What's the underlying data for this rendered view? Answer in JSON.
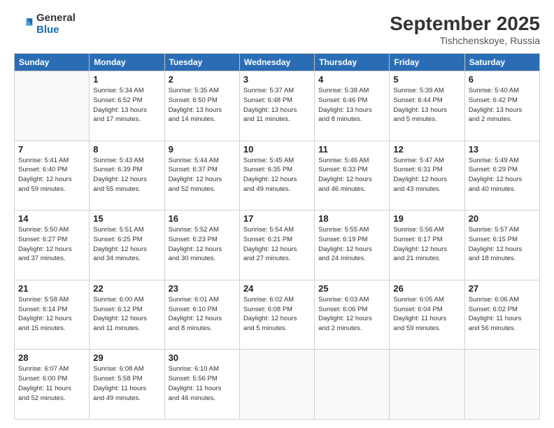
{
  "header": {
    "logo_general": "General",
    "logo_blue": "Blue",
    "month_title": "September 2025",
    "location": "Tishchenskoye, Russia"
  },
  "days_of_week": [
    "Sunday",
    "Monday",
    "Tuesday",
    "Wednesday",
    "Thursday",
    "Friday",
    "Saturday"
  ],
  "weeks": [
    [
      {
        "day": "",
        "info": ""
      },
      {
        "day": "1",
        "info": "Sunrise: 5:34 AM\nSunset: 6:52 PM\nDaylight: 13 hours\nand 17 minutes."
      },
      {
        "day": "2",
        "info": "Sunrise: 5:35 AM\nSunset: 6:50 PM\nDaylight: 13 hours\nand 14 minutes."
      },
      {
        "day": "3",
        "info": "Sunrise: 5:37 AM\nSunset: 6:48 PM\nDaylight: 13 hours\nand 11 minutes."
      },
      {
        "day": "4",
        "info": "Sunrise: 5:38 AM\nSunset: 6:46 PM\nDaylight: 13 hours\nand 8 minutes."
      },
      {
        "day": "5",
        "info": "Sunrise: 5:39 AM\nSunset: 6:44 PM\nDaylight: 13 hours\nand 5 minutes."
      },
      {
        "day": "6",
        "info": "Sunrise: 5:40 AM\nSunset: 6:42 PM\nDaylight: 13 hours\nand 2 minutes."
      }
    ],
    [
      {
        "day": "7",
        "info": "Sunrise: 5:41 AM\nSunset: 6:40 PM\nDaylight: 12 hours\nand 59 minutes."
      },
      {
        "day": "8",
        "info": "Sunrise: 5:43 AM\nSunset: 6:39 PM\nDaylight: 12 hours\nand 55 minutes."
      },
      {
        "day": "9",
        "info": "Sunrise: 5:44 AM\nSunset: 6:37 PM\nDaylight: 12 hours\nand 52 minutes."
      },
      {
        "day": "10",
        "info": "Sunrise: 5:45 AM\nSunset: 6:35 PM\nDaylight: 12 hours\nand 49 minutes."
      },
      {
        "day": "11",
        "info": "Sunrise: 5:46 AM\nSunset: 6:33 PM\nDaylight: 12 hours\nand 46 minutes."
      },
      {
        "day": "12",
        "info": "Sunrise: 5:47 AM\nSunset: 6:31 PM\nDaylight: 12 hours\nand 43 minutes."
      },
      {
        "day": "13",
        "info": "Sunrise: 5:49 AM\nSunset: 6:29 PM\nDaylight: 12 hours\nand 40 minutes."
      }
    ],
    [
      {
        "day": "14",
        "info": "Sunrise: 5:50 AM\nSunset: 6:27 PM\nDaylight: 12 hours\nand 37 minutes."
      },
      {
        "day": "15",
        "info": "Sunrise: 5:51 AM\nSunset: 6:25 PM\nDaylight: 12 hours\nand 34 minutes."
      },
      {
        "day": "16",
        "info": "Sunrise: 5:52 AM\nSunset: 6:23 PM\nDaylight: 12 hours\nand 30 minutes."
      },
      {
        "day": "17",
        "info": "Sunrise: 5:54 AM\nSunset: 6:21 PM\nDaylight: 12 hours\nand 27 minutes."
      },
      {
        "day": "18",
        "info": "Sunrise: 5:55 AM\nSunset: 6:19 PM\nDaylight: 12 hours\nand 24 minutes."
      },
      {
        "day": "19",
        "info": "Sunrise: 5:56 AM\nSunset: 6:17 PM\nDaylight: 12 hours\nand 21 minutes."
      },
      {
        "day": "20",
        "info": "Sunrise: 5:57 AM\nSunset: 6:15 PM\nDaylight: 12 hours\nand 18 minutes."
      }
    ],
    [
      {
        "day": "21",
        "info": "Sunrise: 5:58 AM\nSunset: 6:14 PM\nDaylight: 12 hours\nand 15 minutes."
      },
      {
        "day": "22",
        "info": "Sunrise: 6:00 AM\nSunset: 6:12 PM\nDaylight: 12 hours\nand 11 minutes."
      },
      {
        "day": "23",
        "info": "Sunrise: 6:01 AM\nSunset: 6:10 PM\nDaylight: 12 hours\nand 8 minutes."
      },
      {
        "day": "24",
        "info": "Sunrise: 6:02 AM\nSunset: 6:08 PM\nDaylight: 12 hours\nand 5 minutes."
      },
      {
        "day": "25",
        "info": "Sunrise: 6:03 AM\nSunset: 6:06 PM\nDaylight: 12 hours\nand 2 minutes."
      },
      {
        "day": "26",
        "info": "Sunrise: 6:05 AM\nSunset: 6:04 PM\nDaylight: 11 hours\nand 59 minutes."
      },
      {
        "day": "27",
        "info": "Sunrise: 6:06 AM\nSunset: 6:02 PM\nDaylight: 11 hours\nand 56 minutes."
      }
    ],
    [
      {
        "day": "28",
        "info": "Sunrise: 6:07 AM\nSunset: 6:00 PM\nDaylight: 11 hours\nand 52 minutes."
      },
      {
        "day": "29",
        "info": "Sunrise: 6:08 AM\nSunset: 5:58 PM\nDaylight: 11 hours\nand 49 minutes."
      },
      {
        "day": "30",
        "info": "Sunrise: 6:10 AM\nSunset: 5:56 PM\nDaylight: 11 hours\nand 46 minutes."
      },
      {
        "day": "",
        "info": ""
      },
      {
        "day": "",
        "info": ""
      },
      {
        "day": "",
        "info": ""
      },
      {
        "day": "",
        "info": ""
      }
    ]
  ]
}
